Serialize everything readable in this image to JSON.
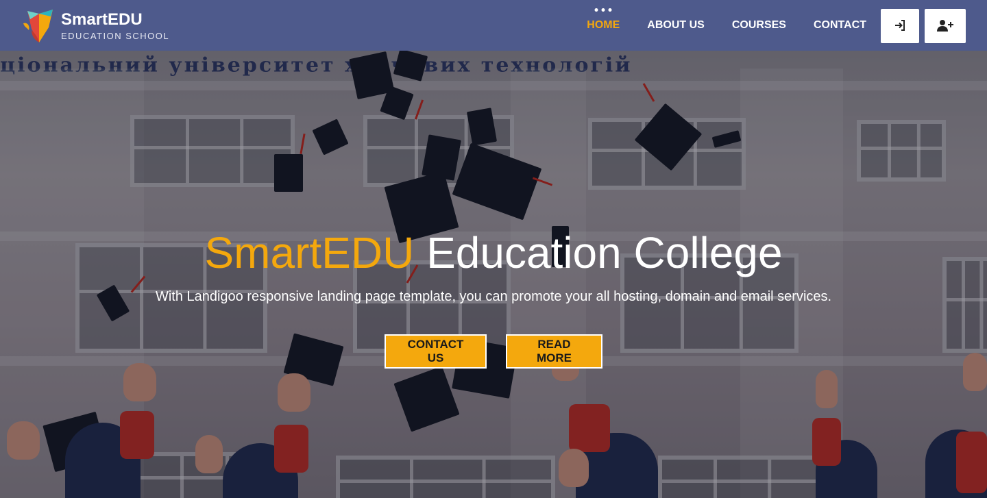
{
  "brand": {
    "name": "SmartEDU",
    "tagline": "EDUCATION SCHOOL"
  },
  "nav": {
    "items": [
      {
        "label": "HOME",
        "active": true
      },
      {
        "label": "ABOUT US",
        "active": false
      },
      {
        "label": "COURSES",
        "active": false
      },
      {
        "label": "CONTACT",
        "active": false
      }
    ],
    "login_icon": "login-icon",
    "register_icon": "user-plus-icon"
  },
  "hero": {
    "title_accent": "SmartEDU",
    "title_rest": " Education College",
    "subtitle": "With Landigoo responsive landing page template, you can promote your all hosting, domain and email services.",
    "facade_text": "ціональний університет харчових технологій",
    "buttons": {
      "contact": "CONTACT US",
      "read_more": "READ MORE"
    }
  },
  "colors": {
    "navbar": "#4e5a8c",
    "accent": "#f4a80d",
    "text": "#ffffff"
  }
}
